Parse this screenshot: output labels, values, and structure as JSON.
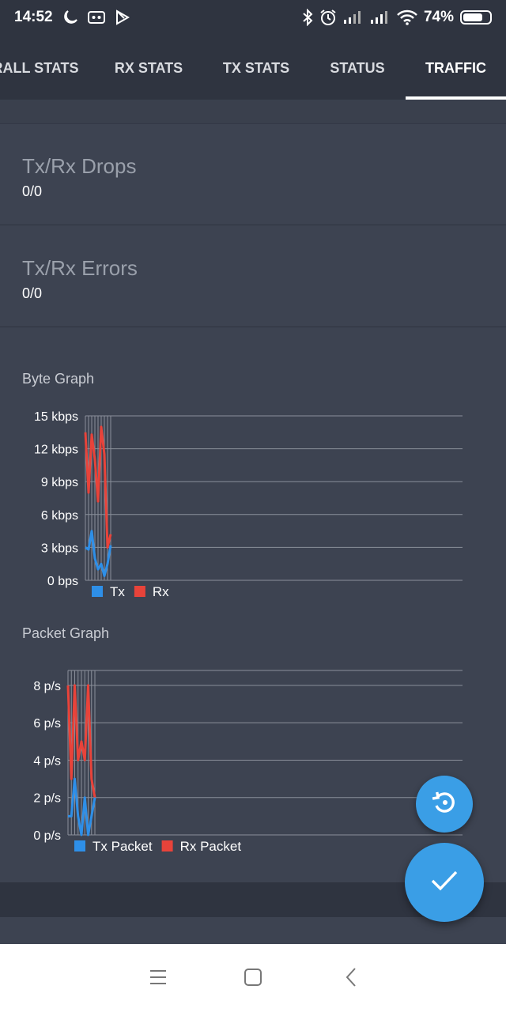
{
  "status_bar": {
    "time": "14:52",
    "battery_percent": "74%",
    "battery_level": 0.74
  },
  "tabs": [
    {
      "label": "RALL STATS",
      "active": false
    },
    {
      "label": "RX STATS",
      "active": false
    },
    {
      "label": "TX STATS",
      "active": false
    },
    {
      "label": "STATUS",
      "active": false
    },
    {
      "label": "TRAFFIC",
      "active": true
    }
  ],
  "drops": {
    "title": "Tx/Rx Drops",
    "value": "0/0"
  },
  "errors": {
    "title": "Tx/Rx Errors",
    "value": "0/0"
  },
  "byte_graph": {
    "title": "Byte Graph"
  },
  "packet_graph": {
    "title": "Packet Graph"
  },
  "colors": {
    "tx": "#2e8fe8",
    "rx": "#e8433a",
    "fab": "#3a9ee6"
  },
  "icons": {
    "fab_small": "history-icon",
    "fab_big": "check-icon"
  },
  "chart_data": [
    {
      "type": "line",
      "title": "Byte Graph",
      "yticks": [
        "0 bps",
        "3 kbps",
        "6 kbps",
        "9 kbps",
        "12 kbps",
        "15 kbps"
      ],
      "ylim": [
        0,
        15
      ],
      "xlim": [
        0,
        117
      ],
      "grid": true,
      "legend": "bottom-left",
      "series": [
        {
          "name": "Tx",
          "color": "#2e8fe8",
          "x": [
            0,
            1,
            2,
            3,
            4,
            5,
            6,
            7,
            8
          ],
          "values": [
            3.0,
            2.8,
            4.5,
            2.0,
            1.0,
            1.5,
            0.4,
            1.5,
            3.2
          ]
        },
        {
          "name": "Rx",
          "color": "#e8433a",
          "x": [
            0,
            1,
            2,
            3,
            4,
            5,
            6,
            7,
            8
          ],
          "values": [
            13.5,
            8.0,
            13.3,
            11.0,
            7.2,
            14.0,
            11.5,
            3.0,
            4.2
          ]
        }
      ]
    },
    {
      "type": "line",
      "title": "Packet Graph",
      "yticks": [
        "0 p/s",
        "2 p/s",
        "4 p/s",
        "6 p/s",
        "8 p/s"
      ],
      "ylim": [
        0,
        8.8
      ],
      "xlim": [
        0,
        118
      ],
      "grid": true,
      "legend": "bottom-left",
      "series": [
        {
          "name": "Tx Packet",
          "color": "#2e8fe8",
          "x": [
            0,
            1,
            2,
            3,
            4,
            5,
            6,
            7,
            8
          ],
          "values": [
            1,
            1,
            3,
            1,
            0,
            2,
            0,
            1,
            2
          ]
        },
        {
          "name": "Rx Packet",
          "color": "#e8433a",
          "x": [
            0,
            1,
            2,
            3,
            4,
            5,
            6,
            7,
            8
          ],
          "values": [
            8,
            3,
            8,
            4,
            5,
            4,
            8,
            3,
            2
          ]
        }
      ]
    }
  ]
}
